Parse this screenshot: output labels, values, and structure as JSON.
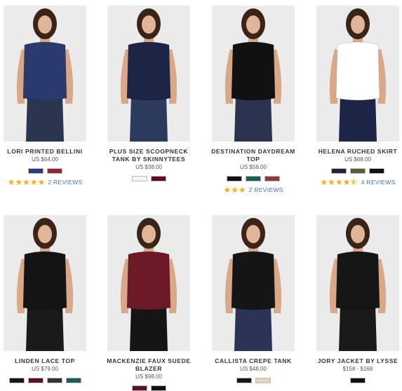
{
  "products": [
    {
      "name": "LORI PRINTED BELLINI",
      "price": "US $64.00",
      "swatches": [
        "#2b3a7a",
        "#8b2a36"
      ],
      "stars": "★★★★★",
      "reviews": "2 REVIEWS",
      "garment": "#2b3a6e",
      "bottom": "#2a3550"
    },
    {
      "name": "PLUS SIZE SCOOPNECK TANK BY SKINNYTEES",
      "price": "US $38.00",
      "swatches": [
        "#f4f4f4",
        "#5a0f1e"
      ],
      "stars": "",
      "reviews": "",
      "garment": "#1d2547",
      "bottom": "#2c3a5c"
    },
    {
      "name": "DESTINATION DAYDREAM TOP",
      "price": "US $58.00",
      "swatches": [
        "#111111",
        "#1d5b55",
        "#8b3a3e"
      ],
      "stars": "★★★",
      "reviews": "2 REVIEWS",
      "garment": "#111111",
      "bottom": "#2b3350"
    },
    {
      "name": "HELENA RUCHED SKIRT",
      "price": "US $68.00",
      "swatches": [
        "#1e2540",
        "#5a5e3c",
        "#111111"
      ],
      "stars": "★★★★⯪",
      "reviews": "4 REVIEWS",
      "garment": "#ffffff",
      "bottom": "#1c2545"
    },
    {
      "name": "LINDEN LACE TOP",
      "price": "US $79.00",
      "swatches": [
        "#151515",
        "#5a1020",
        "#3a3030",
        "#1d5b60"
      ],
      "stars": "",
      "reviews": "",
      "garment": "#141414",
      "bottom": "#1a1a1a"
    },
    {
      "name": "MACKENZIE FAUX SUEDE BLAZER",
      "price": "US $98.00",
      "swatches": [
        "#5a1020",
        "#111111"
      ],
      "stars": "",
      "reviews": "",
      "garment": "#6b1a25",
      "bottom": "#151515"
    },
    {
      "name": "CALLISTA CREPE TANK",
      "price": "US $48.00",
      "swatches": [
        "#151515",
        "#e3d2bc"
      ],
      "stars": "",
      "reviews": "",
      "garment": "#151515",
      "bottom": "#2a3454"
    },
    {
      "name": "JORY JACKET BY LYSSE",
      "price": "$158 - $168",
      "swatches": [
        "#111111"
      ],
      "stars": "",
      "reviews": "",
      "garment": "#161616",
      "bottom": "#1a1a1a"
    }
  ]
}
